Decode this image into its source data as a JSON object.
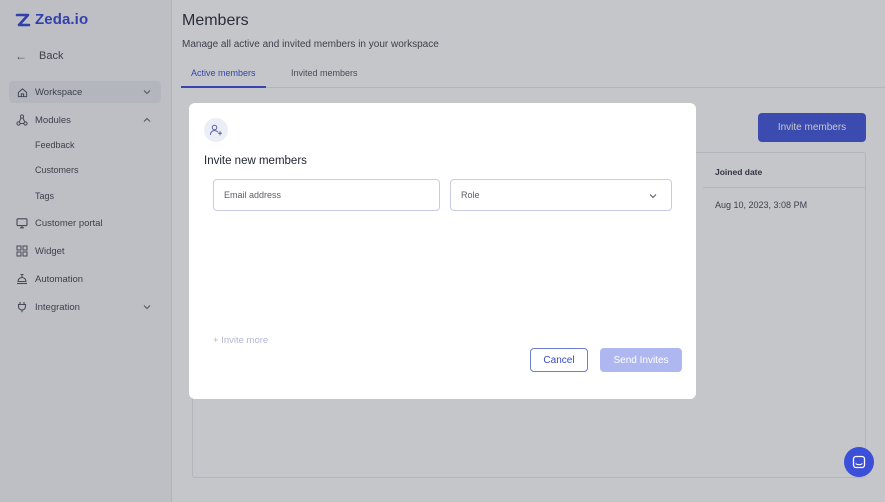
{
  "brand": {
    "name": "Zeda.io",
    "color": "#2d3fd6"
  },
  "sidebar": {
    "back_label": "Back",
    "items": [
      {
        "label": "Workspace",
        "icon": "home-icon",
        "expanded": false,
        "active": true
      },
      {
        "label": "Modules",
        "icon": "modules-icon",
        "expanded": true,
        "active": false
      },
      {
        "label": "Customer portal",
        "icon": "monitor-icon",
        "active": false
      },
      {
        "label": "Widget",
        "icon": "widget-icon",
        "active": false
      },
      {
        "label": "Automation",
        "icon": "automation-icon",
        "active": false
      },
      {
        "label": "Integration",
        "icon": "plug-icon",
        "expanded": false,
        "active": false
      }
    ],
    "sub_items": [
      "Feedback",
      "Customers",
      "Tags"
    ]
  },
  "main": {
    "title": "Members",
    "subtitle": "Manage all active and invited members in your workspace",
    "tabs": [
      {
        "label": "Active members",
        "active": true
      },
      {
        "label": "Invited members",
        "active": false
      }
    ],
    "invite_button_label": "Invite members",
    "table": {
      "column_header": "Joined date",
      "rows": [
        {
          "joined_date": "Aug 10, 2023, 3:08 PM"
        }
      ]
    }
  },
  "modal": {
    "title": "Invite new members",
    "email_placeholder": "Email address",
    "role_placeholder": "Role",
    "invite_more_label": "+ Invite more",
    "cancel_label": "Cancel",
    "send_label": "Send Invites"
  },
  "colors": {
    "accent": "#3b4fd8",
    "accent_disabled": "#aeb7ef",
    "tab_active": "#3346d3"
  }
}
